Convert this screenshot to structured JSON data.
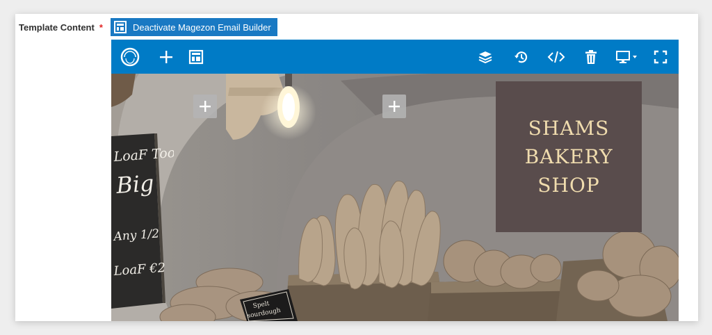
{
  "form": {
    "label": "Template Content",
    "required_mark": "*",
    "deactivate_label": "Deactivate Magezon Email Builder"
  },
  "toolbar": {
    "left_icons": [
      "logo-ring-icon",
      "plus-icon",
      "layout-icon"
    ],
    "right_icons": [
      "layers-icon",
      "history-icon",
      "code-icon",
      "trash-icon",
      "desktop-icon",
      "fullscreen-icon"
    ],
    "color": "#007bc6"
  },
  "canvas": {
    "shop_title_lines": [
      "SHAMS",
      "BAKERY",
      "SHOP"
    ],
    "chalkboard_lines": [
      "LoaF Too",
      "Big",
      "Any 1/2",
      "LoaF €2"
    ],
    "sign_lines": [
      "Spelt",
      "sourdough"
    ],
    "box_color": "#594c4c",
    "title_color": "#f0dcae"
  },
  "colors": {
    "accent": "#1979c3",
    "required": "#e22626"
  }
}
